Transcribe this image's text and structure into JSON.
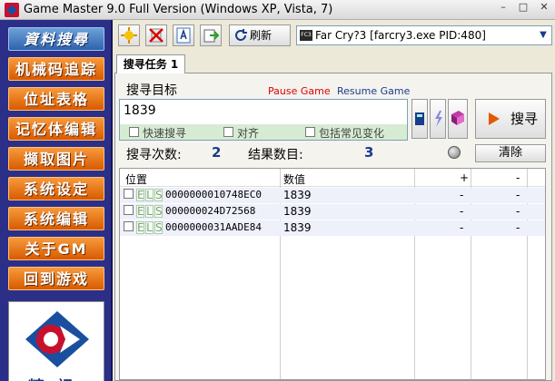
{
  "window": {
    "title": "Game Master 9.0 Full Version (Windows XP, Vista, 7)",
    "minimize": "–",
    "maximize": "□",
    "close": "✕"
  },
  "sidebar": {
    "items": [
      {
        "label": "資料搜尋"
      },
      {
        "label": "机械码追踪"
      },
      {
        "label": "位址表格"
      },
      {
        "label": "记忆体编辑"
      },
      {
        "label": "撷取图片"
      },
      {
        "label": "系统设定"
      },
      {
        "label": "系统编辑"
      },
      {
        "label": "关于GM"
      },
      {
        "label": "回到游戏"
      }
    ],
    "logo_text": "精訊"
  },
  "toolbar": {
    "refresh_label": "刷新",
    "process_icon_text": "FC3",
    "process": "Far Cry?3  [farcry3.exe PID:480]"
  },
  "tab": {
    "label": "搜寻任务 1"
  },
  "search": {
    "target_label": "搜寻目标",
    "pause_label": "Pause Game",
    "resume_label": "Resume Game",
    "value": "1839",
    "options": [
      {
        "label": "快速搜寻"
      },
      {
        "label": "对齐"
      },
      {
        "label": "包括常见变化"
      }
    ],
    "button_label": "搜寻",
    "count_label": "搜寻次数:",
    "count_value": "2",
    "result_label": "结果数目:",
    "result_value": "3",
    "clear_label": "清除"
  },
  "table": {
    "headers": [
      "位置",
      "数值",
      "+",
      "-"
    ],
    "rows": [
      {
        "address": "0000000010748EC0",
        "value": "1839",
        "plus": "-",
        "minus": "-"
      },
      {
        "address": "000000024D72568",
        "value": "1839",
        "plus": "-",
        "minus": "-"
      },
      {
        "address": "0000000031AADE84",
        "value": "1839",
        "plus": "-",
        "minus": "-"
      }
    ],
    "row_flags": [
      "E",
      "L",
      "S"
    ]
  },
  "colors": {
    "sidebar_bg": "#2b2f88",
    "sidebar_button": "#e8741a",
    "accent_blue": "#1a3b8c",
    "pause_red": "#dd0000"
  }
}
